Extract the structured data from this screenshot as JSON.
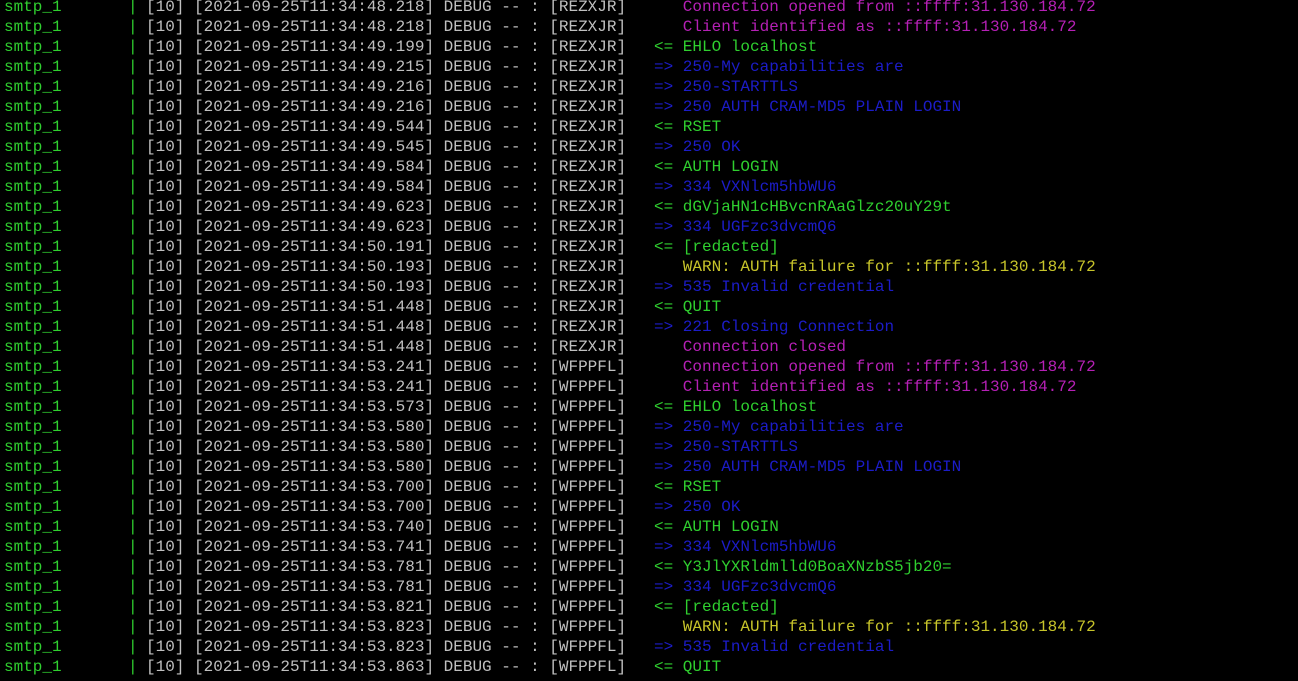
{
  "colors": {
    "background": "#000000",
    "service": "#2fcf2f",
    "meta": "#c0c0c0",
    "magenta": "#b520b5",
    "green": "#2fcf2f",
    "blue": "#1c1cc8",
    "yellow": "#c7c42a"
  },
  "lines": [
    {
      "service": "smtp_1",
      "sep": "|",
      "meta": "[10] [2021-09-25T11:34:48.218] DEBUG -- : [REZXJR]",
      "message": "   Connection opened from ::ffff:31.130.184.72",
      "style": "magenta"
    },
    {
      "service": "smtp_1",
      "sep": "|",
      "meta": "[10] [2021-09-25T11:34:48.218] DEBUG -- : [REZXJR]",
      "message": "   Client identified as ::ffff:31.130.184.72",
      "style": "magenta"
    },
    {
      "service": "smtp_1",
      "sep": "|",
      "meta": "[10] [2021-09-25T11:34:49.199] DEBUG -- : [REZXJR]",
      "message": "<= EHLO localhost",
      "style": "green"
    },
    {
      "service": "smtp_1",
      "sep": "|",
      "meta": "[10] [2021-09-25T11:34:49.215] DEBUG -- : [REZXJR]",
      "message": "=> 250-My capabilities are",
      "style": "blue"
    },
    {
      "service": "smtp_1",
      "sep": "|",
      "meta": "[10] [2021-09-25T11:34:49.216] DEBUG -- : [REZXJR]",
      "message": "=> 250-STARTTLS",
      "style": "blue"
    },
    {
      "service": "smtp_1",
      "sep": "|",
      "meta": "[10] [2021-09-25T11:34:49.216] DEBUG -- : [REZXJR]",
      "message": "=> 250 AUTH CRAM-MD5 PLAIN LOGIN",
      "style": "blue"
    },
    {
      "service": "smtp_1",
      "sep": "|",
      "meta": "[10] [2021-09-25T11:34:49.544] DEBUG -- : [REZXJR]",
      "message": "<= RSET",
      "style": "green"
    },
    {
      "service": "smtp_1",
      "sep": "|",
      "meta": "[10] [2021-09-25T11:34:49.545] DEBUG -- : [REZXJR]",
      "message": "=> 250 OK",
      "style": "blue"
    },
    {
      "service": "smtp_1",
      "sep": "|",
      "meta": "[10] [2021-09-25T11:34:49.584] DEBUG -- : [REZXJR]",
      "message": "<= AUTH LOGIN",
      "style": "green"
    },
    {
      "service": "smtp_1",
      "sep": "|",
      "meta": "[10] [2021-09-25T11:34:49.584] DEBUG -- : [REZXJR]",
      "message": "=> 334 VXNlcm5hbWU6",
      "style": "blue"
    },
    {
      "service": "smtp_1",
      "sep": "|",
      "meta": "[10] [2021-09-25T11:34:49.623] DEBUG -- : [REZXJR]",
      "message": "<= dGVjaHN1cHBvcnRAaGlzc20uY29t",
      "style": "green"
    },
    {
      "service": "smtp_1",
      "sep": "|",
      "meta": "[10] [2021-09-25T11:34:49.623] DEBUG -- : [REZXJR]",
      "message": "=> 334 UGFzc3dvcmQ6",
      "style": "blue"
    },
    {
      "service": "smtp_1",
      "sep": "|",
      "meta": "[10] [2021-09-25T11:34:50.191] DEBUG -- : [REZXJR]",
      "message": "<= [redacted]",
      "style": "green"
    },
    {
      "service": "smtp_1",
      "sep": "|",
      "meta": "[10] [2021-09-25T11:34:50.193] DEBUG -- : [REZXJR]",
      "message": "   WARN: AUTH failure for ::ffff:31.130.184.72",
      "style": "yellow"
    },
    {
      "service": "smtp_1",
      "sep": "|",
      "meta": "[10] [2021-09-25T11:34:50.193] DEBUG -- : [REZXJR]",
      "message": "=> 535 Invalid credential",
      "style": "blue"
    },
    {
      "service": "smtp_1",
      "sep": "|",
      "meta": "[10] [2021-09-25T11:34:51.448] DEBUG -- : [REZXJR]",
      "message": "<= QUIT",
      "style": "green"
    },
    {
      "service": "smtp_1",
      "sep": "|",
      "meta": "[10] [2021-09-25T11:34:51.448] DEBUG -- : [REZXJR]",
      "message": "=> 221 Closing Connection",
      "style": "blue"
    },
    {
      "service": "smtp_1",
      "sep": "|",
      "meta": "[10] [2021-09-25T11:34:51.448] DEBUG -- : [REZXJR]",
      "message": "   Connection closed",
      "style": "magenta"
    },
    {
      "service": "smtp_1",
      "sep": "|",
      "meta": "[10] [2021-09-25T11:34:53.241] DEBUG -- : [WFPPFL]",
      "message": "   Connection opened from ::ffff:31.130.184.72",
      "style": "magenta"
    },
    {
      "service": "smtp_1",
      "sep": "|",
      "meta": "[10] [2021-09-25T11:34:53.241] DEBUG -- : [WFPPFL]",
      "message": "   Client identified as ::ffff:31.130.184.72",
      "style": "magenta"
    },
    {
      "service": "smtp_1",
      "sep": "|",
      "meta": "[10] [2021-09-25T11:34:53.573] DEBUG -- : [WFPPFL]",
      "message": "<= EHLO localhost",
      "style": "green"
    },
    {
      "service": "smtp_1",
      "sep": "|",
      "meta": "[10] [2021-09-25T11:34:53.580] DEBUG -- : [WFPPFL]",
      "message": "=> 250-My capabilities are",
      "style": "blue"
    },
    {
      "service": "smtp_1",
      "sep": "|",
      "meta": "[10] [2021-09-25T11:34:53.580] DEBUG -- : [WFPPFL]",
      "message": "=> 250-STARTTLS",
      "style": "blue"
    },
    {
      "service": "smtp_1",
      "sep": "|",
      "meta": "[10] [2021-09-25T11:34:53.580] DEBUG -- : [WFPPFL]",
      "message": "=> 250 AUTH CRAM-MD5 PLAIN LOGIN",
      "style": "blue"
    },
    {
      "service": "smtp_1",
      "sep": "|",
      "meta": "[10] [2021-09-25T11:34:53.700] DEBUG -- : [WFPPFL]",
      "message": "<= RSET",
      "style": "green"
    },
    {
      "service": "smtp_1",
      "sep": "|",
      "meta": "[10] [2021-09-25T11:34:53.700] DEBUG -- : [WFPPFL]",
      "message": "=> 250 OK",
      "style": "blue"
    },
    {
      "service": "smtp_1",
      "sep": "|",
      "meta": "[10] [2021-09-25T11:34:53.740] DEBUG -- : [WFPPFL]",
      "message": "<= AUTH LOGIN",
      "style": "green"
    },
    {
      "service": "smtp_1",
      "sep": "|",
      "meta": "[10] [2021-09-25T11:34:53.741] DEBUG -- : [WFPPFL]",
      "message": "=> 334 VXNlcm5hbWU6",
      "style": "blue"
    },
    {
      "service": "smtp_1",
      "sep": "|",
      "meta": "[10] [2021-09-25T11:34:53.781] DEBUG -- : [WFPPFL]",
      "message": "<= Y3JlYXRldmlld0BoaXNzbS5jb20=",
      "style": "green"
    },
    {
      "service": "smtp_1",
      "sep": "|",
      "meta": "[10] [2021-09-25T11:34:53.781] DEBUG -- : [WFPPFL]",
      "message": "=> 334 UGFzc3dvcmQ6",
      "style": "blue"
    },
    {
      "service": "smtp_1",
      "sep": "|",
      "meta": "[10] [2021-09-25T11:34:53.821] DEBUG -- : [WFPPFL]",
      "message": "<= [redacted]",
      "style": "green"
    },
    {
      "service": "smtp_1",
      "sep": "|",
      "meta": "[10] [2021-09-25T11:34:53.823] DEBUG -- : [WFPPFL]",
      "message": "   WARN: AUTH failure for ::ffff:31.130.184.72",
      "style": "yellow"
    },
    {
      "service": "smtp_1",
      "sep": "|",
      "meta": "[10] [2021-09-25T11:34:53.823] DEBUG -- : [WFPPFL]",
      "message": "=> 535 Invalid credential",
      "style": "blue"
    },
    {
      "service": "smtp_1",
      "sep": "|",
      "meta": "[10] [2021-09-25T11:34:53.863] DEBUG -- : [WFPPFL]",
      "message": "<= QUIT",
      "style": "green"
    }
  ]
}
